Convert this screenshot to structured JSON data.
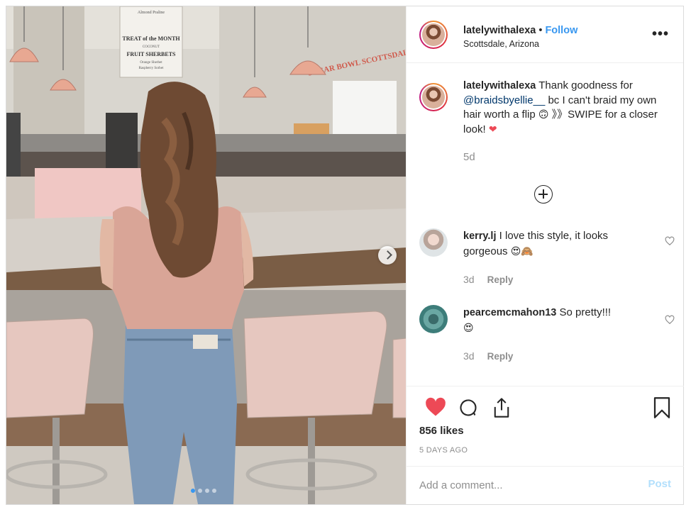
{
  "post": {
    "username": "latelywithalexa",
    "separator": "•",
    "follow_label": "Follow",
    "location": "Scottsdale, Arizona",
    "more_label": "•••",
    "photo_alt": "Woman with braided hair at an ice cream parlor counter",
    "carousel": {
      "count": 4,
      "active": 0
    }
  },
  "photo_text": {
    "sign_line1": "TREAT of the MONTH",
    "sign_line2": "COCONUT",
    "sign_line3": "FRUIT SHERBETS",
    "sign_line4": "Orange Sherbet",
    "sign_line5": "Raspberry Sorbet",
    "sign_top": "Almond Praline",
    "banner": "SUGAR BOWL SCOTTSDALE"
  },
  "caption": {
    "username": "latelywithalexa",
    "text_before": " Thank goodness for ",
    "mention": "@braidsbyellie__",
    "text_after": " bc I can't braid my own hair worth a flip ",
    "emoji1": "🙃",
    "text_swipe": " 》》SWIPE for a closer look! ",
    "emoji2": "❤",
    "time": "5d"
  },
  "comments": [
    {
      "username": "kerry.lj",
      "text": " I love this style, it looks gorgeous ",
      "emoji": "😍🙈",
      "time": "3d",
      "reply_label": "Reply"
    },
    {
      "username": "pearcemcmahon13",
      "text": " So pretty!!! ",
      "emoji": "😍",
      "time": "3d",
      "reply_label": "Reply"
    }
  ],
  "stats": {
    "likes": "856 likes",
    "time_ago": "5 DAYS AGO"
  },
  "comment_box": {
    "placeholder": "Add a comment...",
    "post_label": "Post"
  },
  "colors": {
    "accent": "#3897f0",
    "heart": "#ed4956",
    "post_disabled": "#b2dffc",
    "muted": "#8e8e8e"
  }
}
